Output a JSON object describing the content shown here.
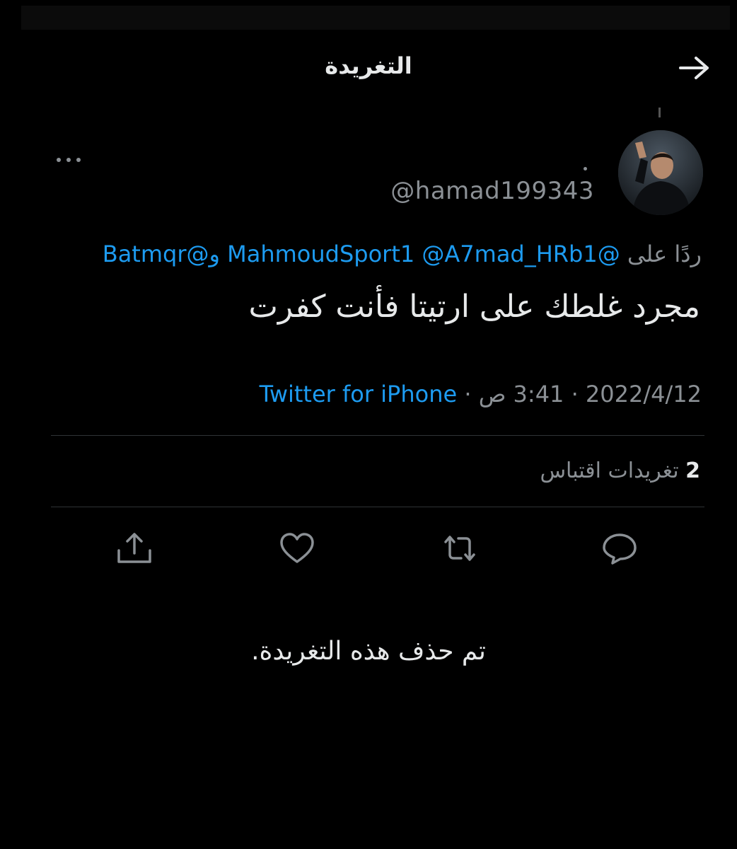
{
  "header": {
    "title": "التغريدة"
  },
  "tweet": {
    "handle": "@hamad199343",
    "reply_prefix": "ردًا على",
    "reply_mentions": [
      "@MahmoudSport1",
      "@A7mad_HRb1",
      "@Batmqr"
    ],
    "reply_conjunction": "و",
    "text": "مجرد غلطك على ارتيتا فأنت كفرت",
    "date": "2022/4/12",
    "time": "3:41 ص",
    "separator": "·",
    "source": "Twitter for iPhone",
    "quote_count": "2",
    "quote_label": "تغريدات اقتباس"
  },
  "actions": [
    "reply-icon",
    "retweet-icon",
    "like-icon",
    "share-icon"
  ],
  "notice": "تم حذف هذه التغريدة.",
  "colors": {
    "background": "#000000",
    "text": "#e7e9ea",
    "muted": "#8b9095",
    "link": "#1d9bf0",
    "divider": "#2f3336"
  }
}
